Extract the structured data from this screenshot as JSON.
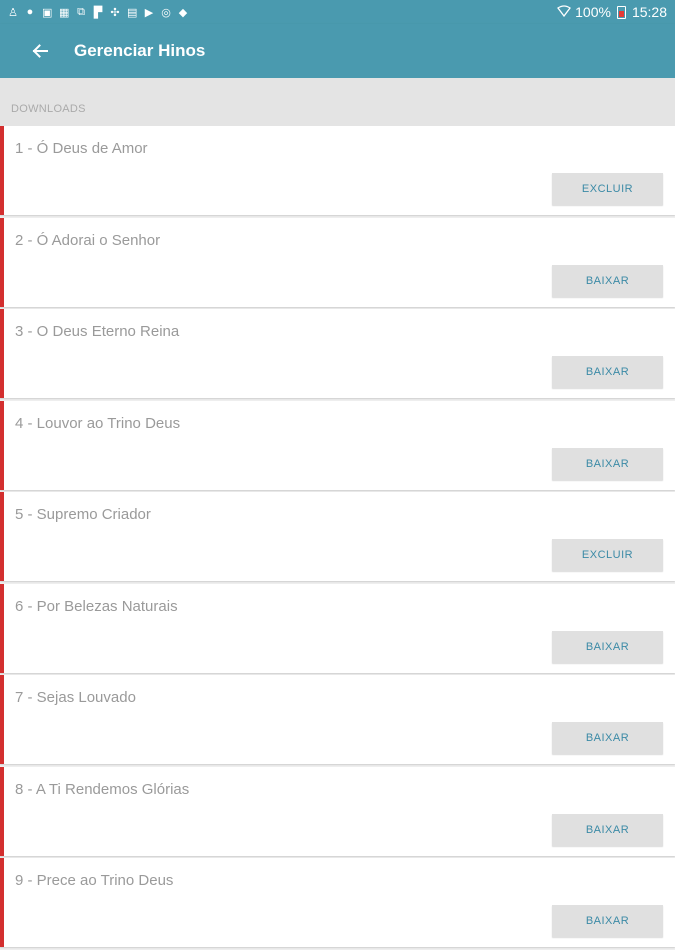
{
  "status_bar": {
    "left_icons": [
      "person-icon",
      "location-icon",
      "image-icon",
      "photos-icon",
      "copy-icon",
      "flipboard-icon",
      "settings-icon",
      "mail-icon",
      "youtube-icon",
      "dribbble-icon",
      "dropbox-icon"
    ],
    "battery": "100%",
    "time": "15:28"
  },
  "toolbar": {
    "back_icon": "arrow-left-icon",
    "title": "Gerenciar Hinos"
  },
  "section": {
    "label": "DOWNLOADS"
  },
  "colors": {
    "appbar": "#4a9aaf",
    "accent_bar": "#d32f2f",
    "button_text": "#3b8aa6"
  },
  "hymns": [
    {
      "title": "1 - Ó Deus de Amor",
      "action": "EXCLUIR"
    },
    {
      "title": "2 - Ó Adorai o Senhor",
      "action": "BAIXAR"
    },
    {
      "title": "3 - O Deus Eterno Reina",
      "action": "BAIXAR"
    },
    {
      "title": "4 - Louvor ao Trino Deus",
      "action": "BAIXAR"
    },
    {
      "title": "5 - Supremo Criador",
      "action": "EXCLUIR"
    },
    {
      "title": "6 - Por Belezas Naturais",
      "action": "BAIXAR"
    },
    {
      "title": "7 - Sejas Louvado",
      "action": "BAIXAR"
    },
    {
      "title": "8 - A Ti Rendemos Glórias",
      "action": "BAIXAR"
    },
    {
      "title": "9 - Prece ao Trino Deus",
      "action": "BAIXAR"
    }
  ]
}
